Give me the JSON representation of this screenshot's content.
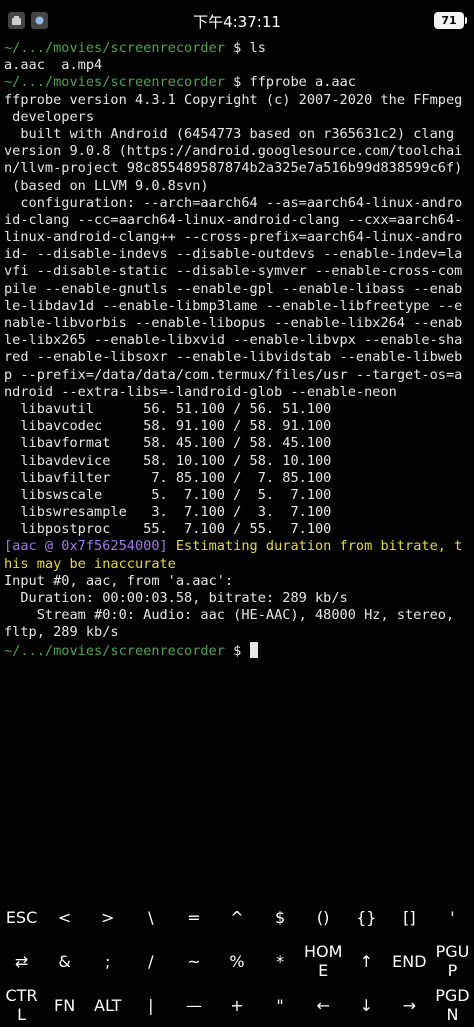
{
  "status_bar": {
    "time": "下午4:37:11",
    "battery": "71"
  },
  "terminal": {
    "prompt_path": "~/.../movies/screenrecorder",
    "prompt_symbol": "$",
    "lines": [
      {
        "type": "prompt",
        "cmd": "ls"
      },
      {
        "type": "out",
        "text": "a.aac  a.mp4"
      },
      {
        "type": "prompt",
        "cmd": "ffprobe a.aac"
      },
      {
        "type": "out",
        "text": "ffprobe version 4.3.1 Copyright (c) 2007-2020 the FFmpeg"
      },
      {
        "type": "out",
        "text": " developers"
      },
      {
        "type": "out",
        "text": "  built with Android (6454773 based on r365631c2) clang"
      },
      {
        "type": "out",
        "text": "version 9.0.8 (https://android.googlesource.com/toolchai"
      },
      {
        "type": "out",
        "text": "n/llvm-project 98c855489587874b2a325e7a516b99d838599c6f)"
      },
      {
        "type": "out",
        "text": " (based on LLVM 9.0.8svn)"
      },
      {
        "type": "out",
        "text": "  configuration: --arch=aarch64 --as=aarch64-linux-andro"
      },
      {
        "type": "out",
        "text": "id-clang --cc=aarch64-linux-android-clang --cxx=aarch64-"
      },
      {
        "type": "out",
        "text": "linux-android-clang++ --cross-prefix=aarch64-linux-andro"
      },
      {
        "type": "out",
        "text": "id- --disable-indevs --disable-outdevs --enable-indev=la"
      },
      {
        "type": "out",
        "text": "vfi --disable-static --disable-symver --enable-cross-com"
      },
      {
        "type": "out",
        "text": "pile --enable-gnutls --enable-gpl --enable-libass --enab"
      },
      {
        "type": "out",
        "text": "le-libdav1d --enable-libmp3lame --enable-libfreetype --e"
      },
      {
        "type": "out",
        "text": "nable-libvorbis --enable-libopus --enable-libx264 --enab"
      },
      {
        "type": "out",
        "text": "le-libx265 --enable-libxvid --enable-libvpx --enable-sha"
      },
      {
        "type": "out",
        "text": "red --enable-libsoxr --enable-libvidstab --enable-libweb"
      },
      {
        "type": "out",
        "text": "p --prefix=/data/data/com.termux/files/usr --target-os=a"
      },
      {
        "type": "out",
        "text": "ndroid --extra-libs=-landroid-glob --enable-neon"
      },
      {
        "type": "out",
        "text": "  libavutil      56. 51.100 / 56. 51.100"
      },
      {
        "type": "out",
        "text": "  libavcodec     58. 91.100 / 58. 91.100"
      },
      {
        "type": "out",
        "text": "  libavformat    58. 45.100 / 58. 45.100"
      },
      {
        "type": "out",
        "text": "  libavdevice    58. 10.100 / 58. 10.100"
      },
      {
        "type": "out",
        "text": "  libavfilter     7. 85.100 /  7. 85.100"
      },
      {
        "type": "out",
        "text": "  libswscale      5.  7.100 /  5.  7.100"
      },
      {
        "type": "out",
        "text": "  libswresample   3.  7.100 /  3.  7.100"
      },
      {
        "type": "out",
        "text": "  libpostproc    55.  7.100 / 55.  7.100"
      },
      {
        "type": "warn",
        "tag": "[aac @ 0x7f56254000]",
        "text": " Estimating duration from bitrate, t"
      },
      {
        "type": "warnc",
        "text": "his may be inaccurate"
      },
      {
        "type": "out",
        "text": "Input #0, aac, from 'a.aac':"
      },
      {
        "type": "out",
        "text": "  Duration: 00:00:03.58, bitrate: 289 kb/s"
      },
      {
        "type": "out",
        "text": "    Stream #0:0: Audio: aac (HE-AAC), 48000 Hz, stereo,"
      },
      {
        "type": "out",
        "text": "fltp, 289 kb/s"
      },
      {
        "type": "cursor"
      }
    ]
  },
  "extra_keys": [
    [
      "ESC",
      "<",
      ">",
      "\\",
      "=",
      "^",
      "$",
      "()",
      "{}",
      "[]",
      "'"
    ],
    [
      "⇄",
      "&",
      ";",
      "/",
      "~",
      "%",
      "*",
      "HOM\nE",
      "↑",
      "END",
      "PGU\nP"
    ],
    [
      "CTR\nL",
      "FN",
      "ALT",
      "|",
      "—",
      "+",
      "\"",
      "←",
      "↓",
      "→",
      "PGD\nN"
    ]
  ]
}
